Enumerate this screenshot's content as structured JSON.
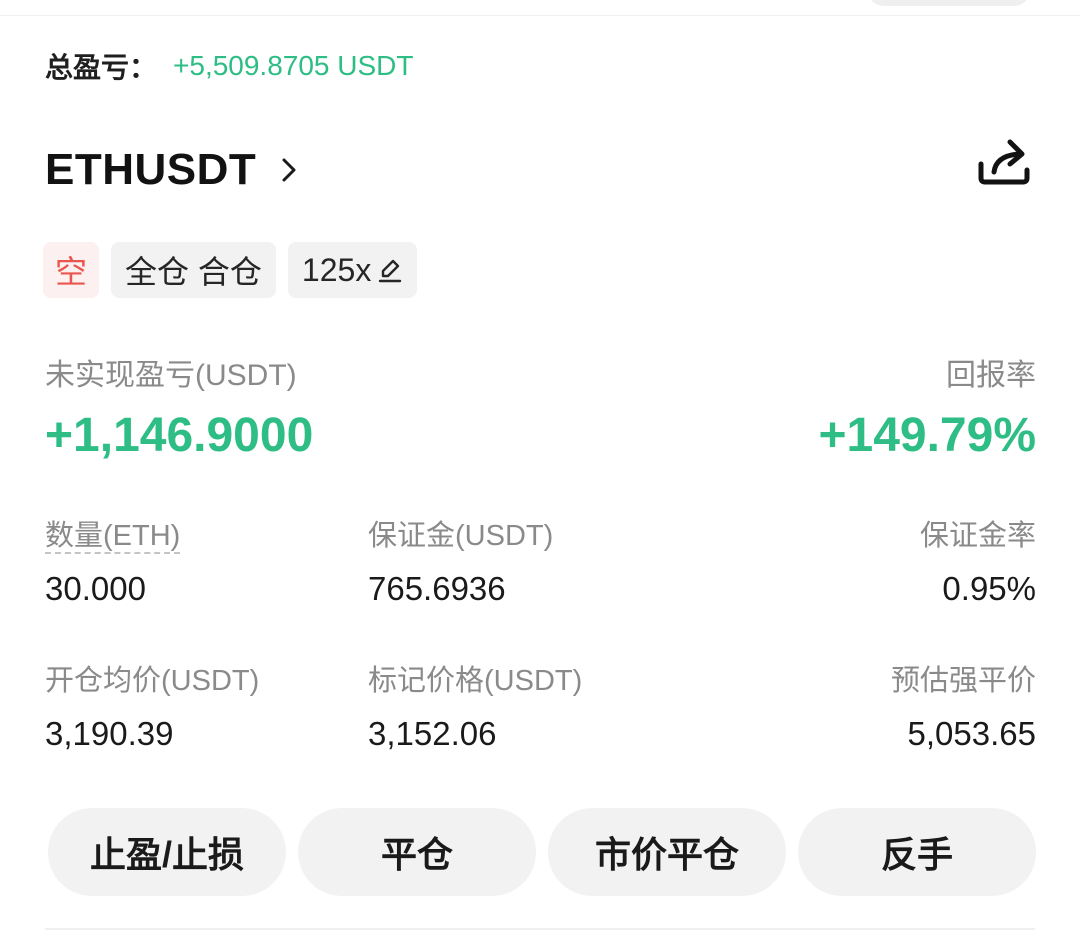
{
  "summary": {
    "total_pnl_label": "总盈亏：",
    "total_pnl_value": "+5,509.8705 USDT"
  },
  "position": {
    "symbol": "ETHUSDT",
    "tags": {
      "side": "空",
      "margin_mode": "全仓 合仓",
      "leverage": "125x"
    },
    "unrealized_pnl_label": "未实现盈亏(USDT)",
    "unrealized_pnl_value": "+1,146.9000",
    "roe_label": "回报率",
    "roe_value": "+149.79%",
    "metrics": {
      "quantity_label": "数量(ETH)",
      "quantity_value": "30.000",
      "margin_label": "保证金(USDT)",
      "margin_value": "765.6936",
      "margin_ratio_label": "保证金率",
      "margin_ratio_value": "0.95%",
      "entry_price_label": "开仓均价(USDT)",
      "entry_price_value": "3,190.39",
      "mark_price_label": "标记价格(USDT)",
      "mark_price_value": "3,152.06",
      "liq_price_label": "预估强平价",
      "liq_price_value": "5,053.65"
    }
  },
  "actions": {
    "tp_sl": "止盈/止损",
    "close": "平仓",
    "market_close": "市价平仓",
    "reverse": "反手"
  },
  "icons": {
    "symbol_chevron": "chevron-right-icon",
    "share": "share-icon",
    "leverage_edit": "pencil-icon"
  },
  "colors": {
    "profit_green": "#2dbd85",
    "short_red": "#e8574f",
    "muted_text": "#8a8a8a"
  }
}
